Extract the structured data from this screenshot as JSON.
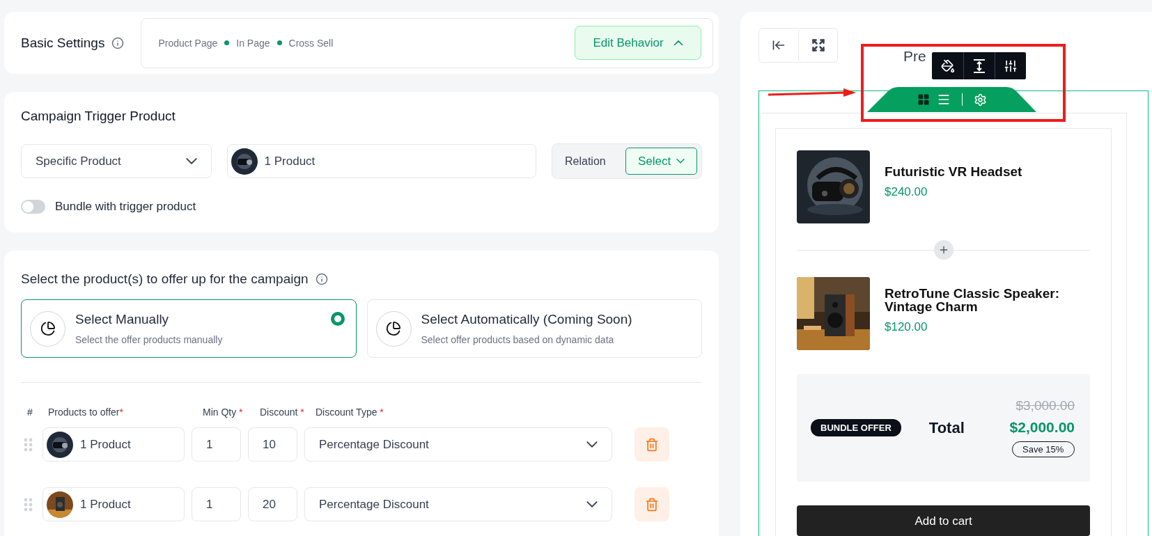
{
  "basic_settings": {
    "title": "Basic Settings",
    "breadcrumb": [
      "Product Page",
      "In Page",
      "Cross Sell"
    ],
    "edit_button": "Edit Behavior",
    "expanded": true
  },
  "trigger": {
    "title": "Campaign Trigger Product",
    "type_select": "Specific Product",
    "product_field": "1 Product",
    "relation_label": "Relation",
    "relation_select": "Select",
    "bundle_toggle": {
      "label": "Bundle with trigger product",
      "on": false
    }
  },
  "offer": {
    "title": "Select the product(s) to offer up for the campaign",
    "options": [
      {
        "title": "Select Manually",
        "description": "Select the offer products manually",
        "selected": true
      },
      {
        "title": "Select Automatically (Coming Soon)",
        "description": "Select offer products based on dynamic data",
        "selected": false
      }
    ],
    "columns": [
      {
        "label": "#"
      },
      {
        "label": "Products to offer",
        "mark": "*"
      },
      {
        "label": "Min Qty",
        "mark": " *"
      },
      {
        "label": "Discount",
        "mark": " *"
      },
      {
        "label": "Discount Type",
        "mark": " *"
      }
    ],
    "rows": [
      {
        "product": "1 Product",
        "min_qty": "1",
        "discount": "10",
        "discount_type": "Percentage Discount"
      },
      {
        "product": "1 Product",
        "min_qty": "1",
        "discount": "20",
        "discount_type": "Percentage Discount"
      }
    ]
  },
  "preview": {
    "title": "Pre",
    "products": [
      {
        "name": "Futuristic VR Headset",
        "price": "$240.00"
      },
      {
        "name": "RetroTune Classic Speaker: Vintage Charm",
        "price": "$120.00"
      }
    ],
    "bundle": {
      "badge": "BUNDLE OFFER",
      "total_label": "Total",
      "original_price": "$3,000.00",
      "price": "$2,000.00",
      "savings": "Save 15%"
    },
    "add_to_cart": "Add to cart"
  }
}
